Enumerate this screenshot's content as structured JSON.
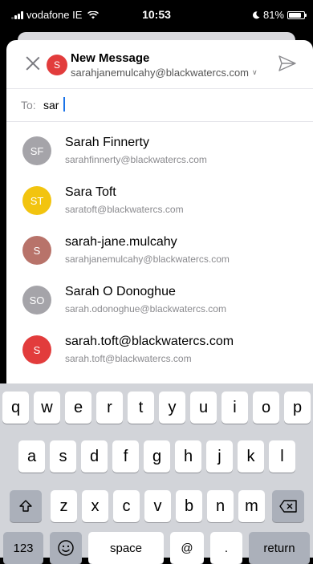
{
  "status_bar": {
    "carrier": "vodafone IE",
    "time": "10:53",
    "battery": "81%",
    "battery_level": 0.81
  },
  "header": {
    "avatar_initial": "S",
    "title": "New Message",
    "sender_email": "sarahjanemulcahy@blackwatercs.com"
  },
  "to_field": {
    "label": "To:",
    "value": "sar"
  },
  "suggestions": [
    {
      "initials": "SF",
      "name": "Sarah Finnerty",
      "email": "sarahfinnerty@blackwatercs.com",
      "color": "#a5a4a9"
    },
    {
      "initials": "ST",
      "name": "Sara Toft",
      "email": "saratoft@blackwatercs.com",
      "color": "#f2c40f"
    },
    {
      "initials": "S",
      "name": "sarah-jane.mulcahy",
      "email": "sarahjanemulcahy@blackwatercs.com",
      "color": "#b8736a"
    },
    {
      "initials": "SO",
      "name": "Sarah O Donoghue",
      "email": "sarah.odonoghue@blackwatercs.com",
      "color": "#a5a4a9"
    },
    {
      "initials": "S",
      "name": "sarah.toft@blackwatercs.com",
      "email": "sarah.toft@blackwatercs.com",
      "color": "#e23c3c"
    }
  ],
  "keyboard": {
    "row1": [
      "q",
      "w",
      "e",
      "r",
      "t",
      "y",
      "u",
      "i",
      "o",
      "p"
    ],
    "row2": [
      "a",
      "s",
      "d",
      "f",
      "g",
      "h",
      "j",
      "k",
      "l"
    ],
    "row3": [
      "z",
      "x",
      "c",
      "v",
      "b",
      "n",
      "m"
    ],
    "numbers_label": "123",
    "space_label": "space",
    "at_label": "@",
    "dot_label": ".",
    "return_label": "return"
  }
}
